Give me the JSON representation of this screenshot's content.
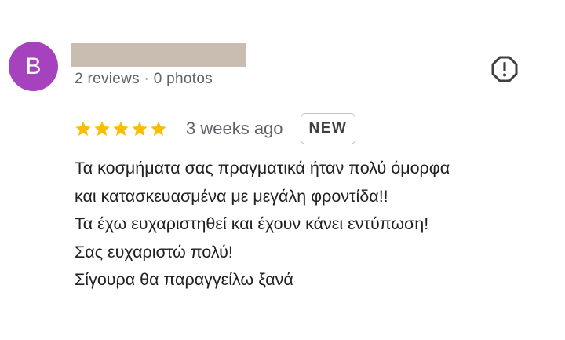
{
  "reviewer": {
    "avatar_letter": "B",
    "avatar_color": "#a742bf",
    "meta": "2 reviews · 0 photos"
  },
  "actions": {
    "report_icon": "exclamation-octagon-icon"
  },
  "review": {
    "stars": 5,
    "star_color": "#fbbc04",
    "time": "3 weeks ago",
    "badge": "NEW",
    "lines": [
      "Τα κοσμήματα σας πραγματικά ήταν πολύ όμορφα",
      "και κατασκευασμένα με μεγάλη φροντίδα!!",
      "Τα έχω ευχαριστηθεί και έχουν κάνει εντύπωση!",
      "Σας ευχαριστώ πολύ!",
      "Σίγουρα θα παραγγείλω ξανά"
    ]
  }
}
